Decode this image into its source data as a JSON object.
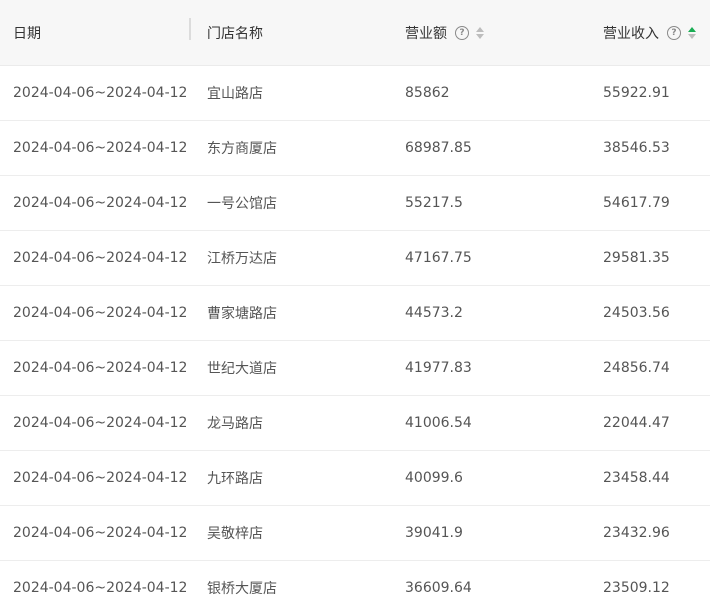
{
  "table": {
    "headers": {
      "date": "日期",
      "store": "门店名称",
      "revenue": "营业额",
      "income": "营业收入"
    },
    "rows": [
      {
        "date": "2024-04-06~2024-04-12",
        "store": "宜山路店",
        "revenue": "85862",
        "income": "55922.91"
      },
      {
        "date": "2024-04-06~2024-04-12",
        "store": "东方商厦店",
        "revenue": "68987.85",
        "income": "38546.53"
      },
      {
        "date": "2024-04-06~2024-04-12",
        "store": "一号公馆店",
        "revenue": "55217.5",
        "income": "54617.79"
      },
      {
        "date": "2024-04-06~2024-04-12",
        "store": "江桥万达店",
        "revenue": "47167.75",
        "income": "29581.35"
      },
      {
        "date": "2024-04-06~2024-04-12",
        "store": "曹家塘路店",
        "revenue": "44573.2",
        "income": "24503.56"
      },
      {
        "date": "2024-04-06~2024-04-12",
        "store": "世纪大道店",
        "revenue": "41977.83",
        "income": "24856.74"
      },
      {
        "date": "2024-04-06~2024-04-12",
        "store": "龙马路店",
        "revenue": "41006.54",
        "income": "22044.47"
      },
      {
        "date": "2024-04-06~2024-04-12",
        "store": "九环路店",
        "revenue": "40099.6",
        "income": "23458.44"
      },
      {
        "date": "2024-04-06~2024-04-12",
        "store": "吴敬梓店",
        "revenue": "39041.9",
        "income": "23432.96"
      },
      {
        "date": "2024-04-06~2024-04-12",
        "store": "银桥大厦店",
        "revenue": "36609.64",
        "income": "23509.12"
      }
    ]
  },
  "icons": {
    "help": "question-circle-icon",
    "sort": "sort-caret-icon"
  },
  "colors": {
    "header_bg": "#f7f7f7",
    "sort_active": "#1aad54",
    "sort_inactive": "#bdbdbd",
    "text": "#555555"
  }
}
